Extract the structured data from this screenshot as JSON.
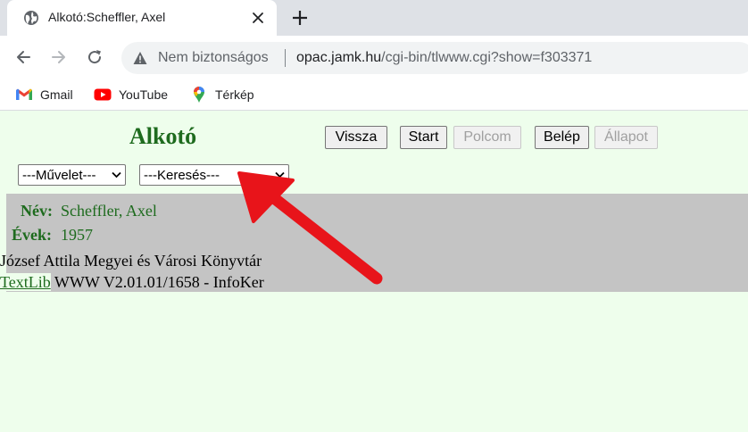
{
  "browser": {
    "tab_title": "Alkotó:Scheffler, Axel",
    "omnibox": {
      "security_label": "Nem biztonságos",
      "url_host": "opac.jamk.hu",
      "url_path": "/cgi-bin/tlwww.cgi?show=f303371"
    },
    "bookmarks": [
      {
        "label": "Gmail",
        "icon": "gmail-icon"
      },
      {
        "label": "YouTube",
        "icon": "youtube-icon"
      },
      {
        "label": "Térkép",
        "icon": "maps-icon"
      }
    ]
  },
  "page": {
    "title": "Alkotó",
    "buttons": {
      "back": "Vissza",
      "start": "Start",
      "shelf": "Polcom",
      "login": "Belép",
      "status": "Állapot"
    },
    "selects": {
      "operation": "---Művelet---",
      "search": "---Keresés---"
    },
    "record": {
      "name_label": "Név:",
      "name_value": "Scheffler, Axel",
      "years_label": "Évek:",
      "years_value": "1957"
    },
    "footer": {
      "library": "József Attila Megyei és Városi Könyvtár",
      "link": "TextLib",
      "version": " WWW V2.01.01/1658 - InfoKer"
    }
  },
  "colors": {
    "page_bg": "#eefeec",
    "accent_green": "#1e6b1e",
    "info_bg": "#c4c4c4",
    "annotation_arrow": "#e8141a"
  }
}
